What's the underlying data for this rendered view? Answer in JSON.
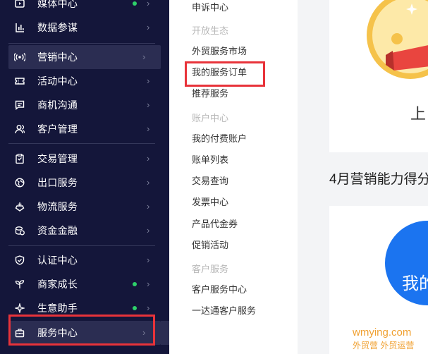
{
  "sidebar": {
    "items": [
      {
        "label": "媒体中心",
        "icon": "media-icon",
        "dot": true
      },
      {
        "label": "数据参谋",
        "icon": "bar-chart-icon",
        "dot": false
      },
      {
        "label": "营销中心",
        "icon": "broadcast-icon",
        "dot": false,
        "active": true
      },
      {
        "label": "活动中心",
        "icon": "ticket-icon",
        "dot": false
      },
      {
        "label": "商机沟通",
        "icon": "chat-icon",
        "dot": false
      },
      {
        "label": "客户管理",
        "icon": "users-icon",
        "dot": false
      },
      {
        "label": "交易管理",
        "icon": "clipboard-icon",
        "dot": false
      },
      {
        "label": "出口服务",
        "icon": "globe-icon",
        "dot": false
      },
      {
        "label": "物流服务",
        "icon": "cargo-icon",
        "dot": false
      },
      {
        "label": "资金金融",
        "icon": "coins-icon",
        "dot": false
      },
      {
        "label": "认证中心",
        "icon": "shield-check-icon",
        "dot": false
      },
      {
        "label": "商家成长",
        "icon": "sprout-icon",
        "dot": true
      },
      {
        "label": "生意助手",
        "icon": "sparkle-icon",
        "dot": true
      },
      {
        "label": "服务中心",
        "icon": "briefcase-icon",
        "dot": false,
        "selected": true
      }
    ]
  },
  "submenu": {
    "items": [
      {
        "text": "申诉中心",
        "type": "link"
      },
      {
        "text": "开放生态",
        "type": "group"
      },
      {
        "text": "外贸服务市场",
        "type": "link"
      },
      {
        "text": "我的服务订单",
        "type": "link",
        "highlighted": true
      },
      {
        "text": "推荐服务",
        "type": "link"
      },
      {
        "text": "账户中心",
        "type": "group"
      },
      {
        "text": "我的付费账户",
        "type": "link"
      },
      {
        "text": "账单列表",
        "type": "link"
      },
      {
        "text": "交易查询",
        "type": "link"
      },
      {
        "text": "发票中心",
        "type": "link"
      },
      {
        "text": "产品代金券",
        "type": "link"
      },
      {
        "text": "促销活动",
        "type": "link"
      },
      {
        "text": "客户服务",
        "type": "group"
      },
      {
        "text": "客户服务中心",
        "type": "link"
      },
      {
        "text": "一达通客户服务",
        "type": "link"
      }
    ]
  },
  "content": {
    "top_card_text": "上",
    "section_title": "4月营销能力得分",
    "bottom_card_text": "我的",
    "watermark_domain": "wmying.com",
    "watermark_tagline": "外贸营 外贸运营"
  },
  "colors": {
    "sidebar_bg": "#14163a",
    "active_bg": "#2b2d52",
    "highlight_red": "#e8333a",
    "dot_green": "#2ed16a",
    "accent_blue": "#1b74f0",
    "badge_gold": "#f5c24a"
  }
}
